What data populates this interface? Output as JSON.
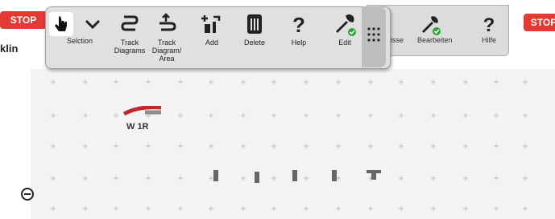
{
  "app": {
    "loco_label": "klin",
    "stop_label": "STOP"
  },
  "toolbar": {
    "items": [
      {
        "id": "pointer",
        "label": ""
      },
      {
        "id": "chevron",
        "label": ""
      },
      {
        "id": "selection",
        "label": "Selction"
      },
      {
        "id": "track-diagrams",
        "label": "Track\nDiagrams"
      },
      {
        "id": "track-diagram-area",
        "label": "Track\nDiagram/\nArea"
      },
      {
        "id": "add",
        "label": "Add"
      },
      {
        "id": "delete",
        "label": "Delete"
      },
      {
        "id": "help",
        "label": "Help"
      },
      {
        "id": "edit",
        "label": "Edit"
      }
    ]
  },
  "back_toolbar": {
    "items": [
      {
        "id": "isse",
        "label": "isse"
      },
      {
        "id": "bearbeiten",
        "label": "Bearbeiten"
      },
      {
        "id": "hilfe",
        "label": "Hilfe"
      }
    ]
  },
  "diagram": {
    "turnout_label": "W 1R"
  },
  "colors": {
    "accent_red": "#e23b36",
    "check_green": "#2ca336",
    "panel_bg": "#e0e0e0"
  }
}
